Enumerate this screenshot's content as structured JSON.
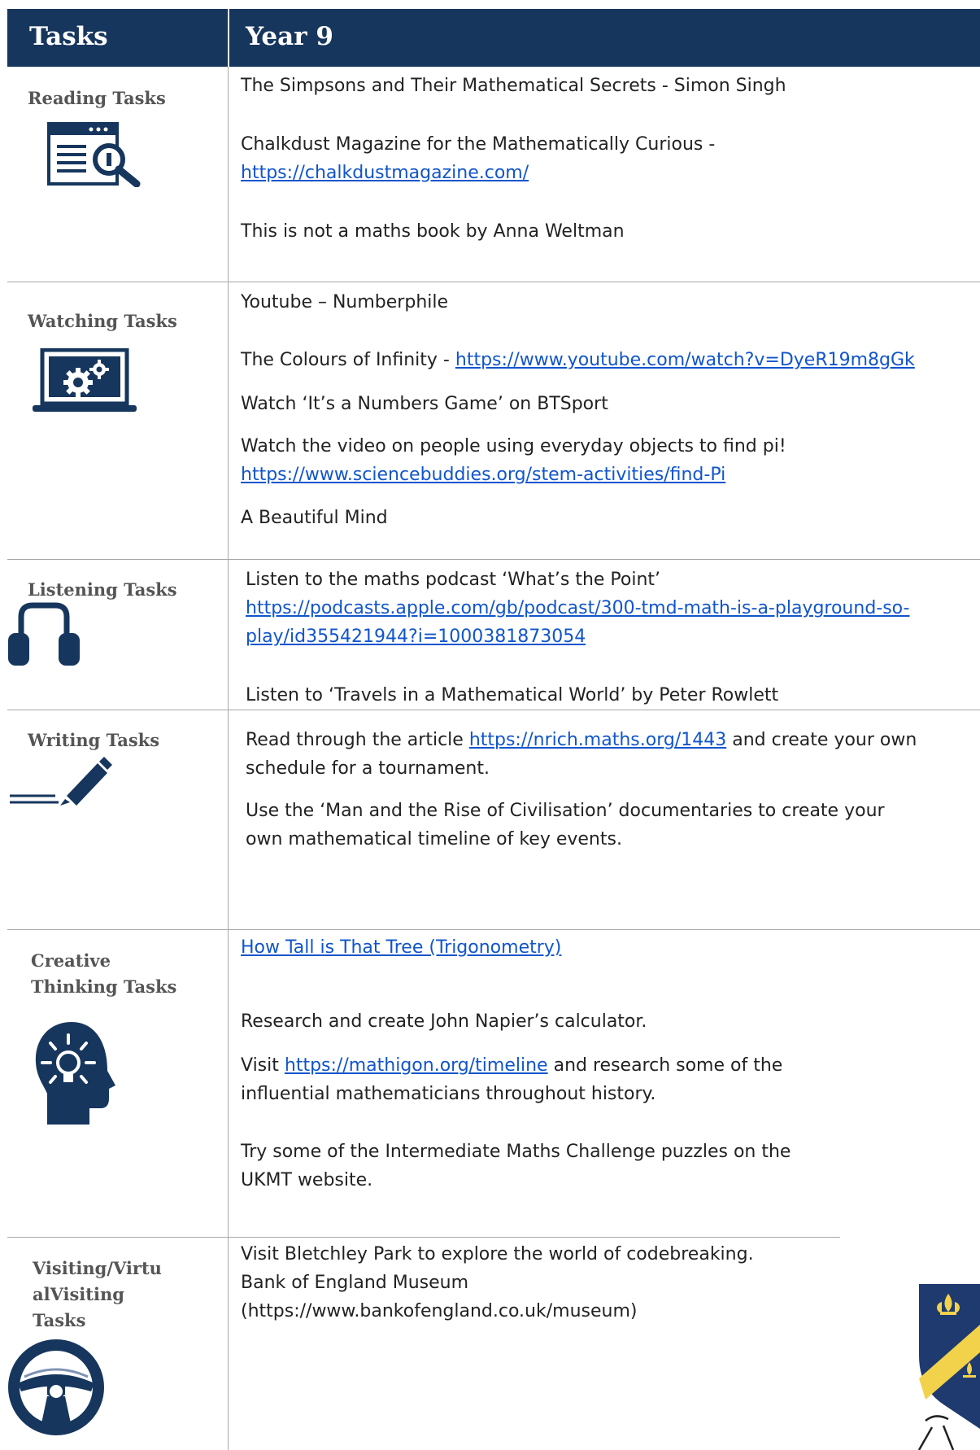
{
  "header": {
    "col1": "Tasks",
    "col2": "Year 9"
  },
  "colors": {
    "navy": "#17365d",
    "link": "#1155cc",
    "label": "#555555"
  },
  "sections": {
    "reading": {
      "label": "Reading Tasks",
      "icon": "document-search-icon",
      "item1": "The Simpsons and Their Mathematical Secrets - Simon Singh",
      "item2_text": "Chalkdust Magazine for the Mathematically Curious -",
      "item2_link": "https://chalkdustmagazine.com/",
      "item3": "This is not a maths book by Anna Weltman"
    },
    "watching": {
      "label": "Watching Tasks",
      "icon": "laptop-gears-icon",
      "item1": "Youtube – Numberphile",
      "item2_text": "The Colours of Infinity - ",
      "item2_link": "https://www.youtube.com/watch?v=DyeR19m8gGk",
      "item3": "Watch ‘It’s a Numbers Game’ on BTSport",
      "item4_text": "Watch the video on people using everyday objects to find pi!",
      "item4_link": "https://www.sciencebuddies.org/stem-activities/find-Pi",
      "item5": "A Beautiful Mind"
    },
    "listening": {
      "label": "Listening Tasks",
      "icon": "headphones-icon",
      "item1_text": "Listen to the maths podcast ‘What’s the Point’",
      "item1_link_line1": "https://podcasts.apple.com/gb/podcast/300-tmd-math-is-a-playground-so-",
      "item1_link_line2": "play/id355421944?i=1000381873054",
      "item2": "Listen to ‘Travels in a Mathematical World’ by Peter Rowlett"
    },
    "writing": {
      "label": "Writing Tasks",
      "icon": "pencil-icon",
      "item1_pre": "Read through the article ",
      "item1_link": "https://nrich.maths.org/1443",
      "item1_post": " and create your own",
      "item1_line2": "schedule for a tournament.",
      "item2_line1": "Use the ‘Man and the Rise of Civilisation’ documentaries to create your",
      "item2_line2": "own mathematical timeline of key events."
    },
    "creative": {
      "label_line1": "Creative",
      "label_line2": "Thinking Tasks",
      "icon": "lightbulb-head-icon",
      "item1_link": "How Tall is That Tree (Trigonometry)",
      "item2": "Research and create John Napier’s calculator.",
      "item3_pre": "Visit ",
      "item3_link": "https://mathigon.org/timeline",
      "item3_post": " and research some of the",
      "item3_line2": "influential mathematicians throughout history.",
      "item4_line1": "Try some of the Intermediate Maths Challenge puzzles on the",
      "item4_line2": "UKMT website."
    },
    "visiting": {
      "label_line1": "Visiting/Virtu",
      "label_line2": "alVisiting",
      "label_line3": "Tasks",
      "icon": "steering-wheel-icon",
      "item1": "Visit Bletchley Park to explore the world of codebreaking.",
      "item2": "Bank of England Museum",
      "item3": "(https://www.bankofengland.co.uk/museum)"
    }
  }
}
